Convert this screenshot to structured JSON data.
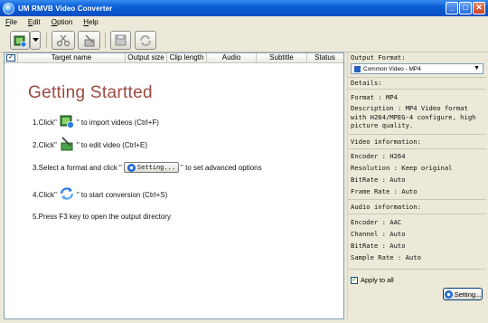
{
  "window": {
    "title": "UM RMVB Video Converter"
  },
  "menubar": {
    "items": [
      {
        "label": "File",
        "accel": "F",
        "rest": "ile"
      },
      {
        "label": "Edit",
        "accel": "E",
        "rest": "dit"
      },
      {
        "label": "Option",
        "accel": "O",
        "rest": "ption"
      },
      {
        "label": "Help",
        "accel": "H",
        "rest": "elp"
      }
    ]
  },
  "toolbar": {
    "icons": [
      "add-video-icon",
      "dropdown-arrow-icon",
      "cut-icon",
      "edit-icon",
      "save-icon",
      "convert-icon"
    ]
  },
  "table": {
    "headers": [
      "Target name",
      "Output size",
      "Clip length",
      "Audio",
      "Subtitle",
      "Status"
    ]
  },
  "guide": {
    "title": "Getting Startted",
    "step1_pre": "1.Click\"",
    "step1_post": "\" to import videos (Ctrl+F)",
    "step2_pre": "2.Click\"",
    "step2_post": "\" to edit video (Ctrl+E)",
    "step3_pre": "3.Select a format and click \"",
    "step3_btn": "Setting...",
    "step3_post": "\" to set advanced options",
    "step4_pre": "4.Click\"",
    "step4_post": "\" to start conversion (Ctrl+S)",
    "step5": "5.Press F3 key to open the output directory"
  },
  "rightpane": {
    "output_format_label": "Output Format:",
    "output_format_value": "Common Video - MP4",
    "details_label": "Details:",
    "format_row": "Format     : MP4",
    "description_row": "Description : MP4 Video format with H264/MPEG-4 configure, high picture quality.",
    "video_info_label": "Video information:",
    "video_rows": [
      "Encoder    : H264",
      "Resolution : Keep original",
      "BitRate    : Auto",
      "Frame Rate : Auto"
    ],
    "audio_info_label": "Audio information:",
    "audio_rows": [
      "Encoder    : AAC",
      "Channel    : Auto",
      "BitRate    : Auto",
      "Sample Rate : Auto"
    ],
    "apply_label": "Apply to all",
    "setting_button": "Setting..."
  },
  "colors": {
    "title_bar": "#0b5fd6",
    "guide_title": "#9c4940",
    "close_button": "#c7411e"
  }
}
